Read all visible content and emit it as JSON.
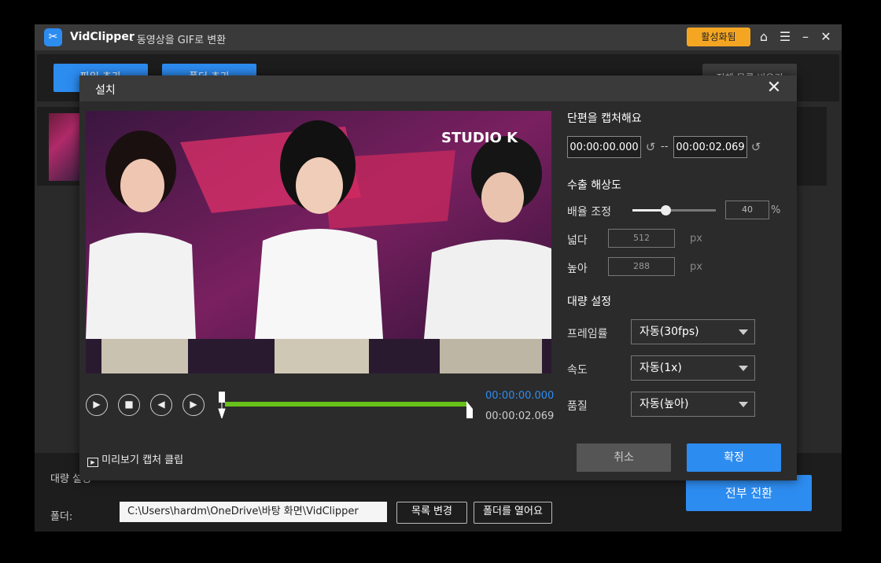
{
  "app": {
    "name": "VidClipper",
    "subtitle": "- 동영상을 GIF로 변환",
    "activate_label": "활성화됨",
    "icons": [
      "home-icon",
      "menu-icon",
      "minimize-icon",
      "close-icon"
    ]
  },
  "main": {
    "add_file_label": "파일 추가",
    "add_folder_label": "폴더 추가",
    "right_label": "전체 목록 비우기",
    "bulk_settings_label": "대량 설정",
    "folder_label": "폴더:",
    "folder_path": "C:\\Users\\hardm\\OneDrive\\바탕 화면\\VidClipper",
    "change_list_label": "목록 변경",
    "open_folder_label": "폴더를 열어요",
    "convert_all_label": "전부 전환"
  },
  "dialog": {
    "title": "설치",
    "capture_title": "단편을 캡처해요",
    "start_time": "00:00:00.000",
    "time_separator": "--",
    "end_time": "00:00:02.069",
    "resolution_title": "수출 해상도",
    "scale_label": "배율 조정",
    "scale_value": "40",
    "scale_percent": 0.4,
    "percent_unit": "%",
    "width_label": "넓다",
    "width_value": "512",
    "height_label": "높아",
    "height_value": "288",
    "px_unit": "px",
    "bulk_title": "대량 설정",
    "framerate_label": "프레임률",
    "framerate_value": "자동(30fps)",
    "speed_label": "속도",
    "speed_value": "자동(1x)",
    "quality_label": "품질",
    "quality_value": "자동(높아)",
    "current_time": "00:00:00.000",
    "total_time": "00:00:02.069",
    "preview_clip_label": "미리보기 캡처 클립",
    "cancel_label": "취소",
    "confirm_label": "확정",
    "watermark": "STUDIO K"
  },
  "colors": {
    "accent": "#2d8cf0",
    "activate": "#f4a623",
    "track": "#67c11a"
  }
}
